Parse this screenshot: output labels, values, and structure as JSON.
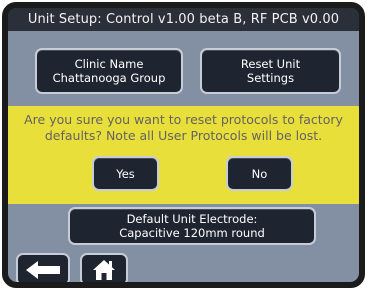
{
  "title": "Unit Setup: Control v1.00 beta B, RF PCB v0.00",
  "clinic": {
    "label": "Clinic Name",
    "value": "Chattanooga Group"
  },
  "reset": {
    "line1": "Reset Unit",
    "line2": "Settings"
  },
  "dialog": {
    "message": "Are you sure you want to reset protocols to factory defaults? Note all User Protocols will be lost.",
    "yes": "Yes",
    "no": "No"
  },
  "electrode": {
    "label": "Default Unit Electrode:",
    "value": "Capacitive 120mm round"
  },
  "nav": {
    "back_icon": "back-arrow-icon",
    "home_icon": "home-icon"
  },
  "colors": {
    "screen_bg": "#8390a3",
    "titlebar_bg": "#2b2f3a",
    "dialog_bg": "#e9df3a",
    "button_bg": "#1f2530"
  }
}
